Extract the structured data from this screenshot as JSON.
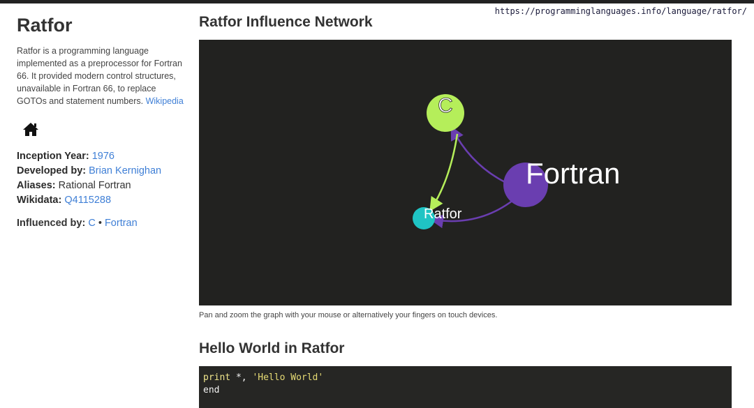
{
  "url": "https://programminglanguages.info/language/ratfor/",
  "sidebar": {
    "title": "Ratfor",
    "description": "Ratfor is a programming language implemented as a preprocessor for Fortran 66. It provided modern control structures, unavailable in Fortran 66, to replace GOTOs and statement numbers.",
    "wikipedia_link": "Wikipedia",
    "home_icon": "home-icon",
    "facts": {
      "inception_label": "Inception Year:",
      "inception_value": "1976",
      "developed_label": "Developed by:",
      "developed_value": "Brian Kernighan",
      "aliases_label": "Aliases:",
      "aliases_value": "Rational Fortran",
      "wikidata_label": "Wikidata:",
      "wikidata_value": "Q4115288"
    },
    "influenced_label": "Influenced by:",
    "influenced": [
      "C",
      "Fortran"
    ],
    "influenced_sep": "•"
  },
  "main": {
    "graph_title": "Ratfor Influence Network",
    "graph_nodes": {
      "c": "C",
      "fortran": "Fortran",
      "ratfor": "Ratfor"
    },
    "graph_colors": {
      "background": "#222220",
      "c": "#b5ee5a",
      "fortran": "#6a3eb0",
      "ratfor": "#1fc4c4"
    },
    "graph_caption": "Pan and zoom the graph with your mouse or alternatively your fingers on touch devices.",
    "hello_title": "Hello World in Ratfor",
    "code_line1_kw": "print",
    "code_line1_mid": " *, ",
    "code_line1_str": "'Hello World'",
    "code_line2": "end"
  }
}
